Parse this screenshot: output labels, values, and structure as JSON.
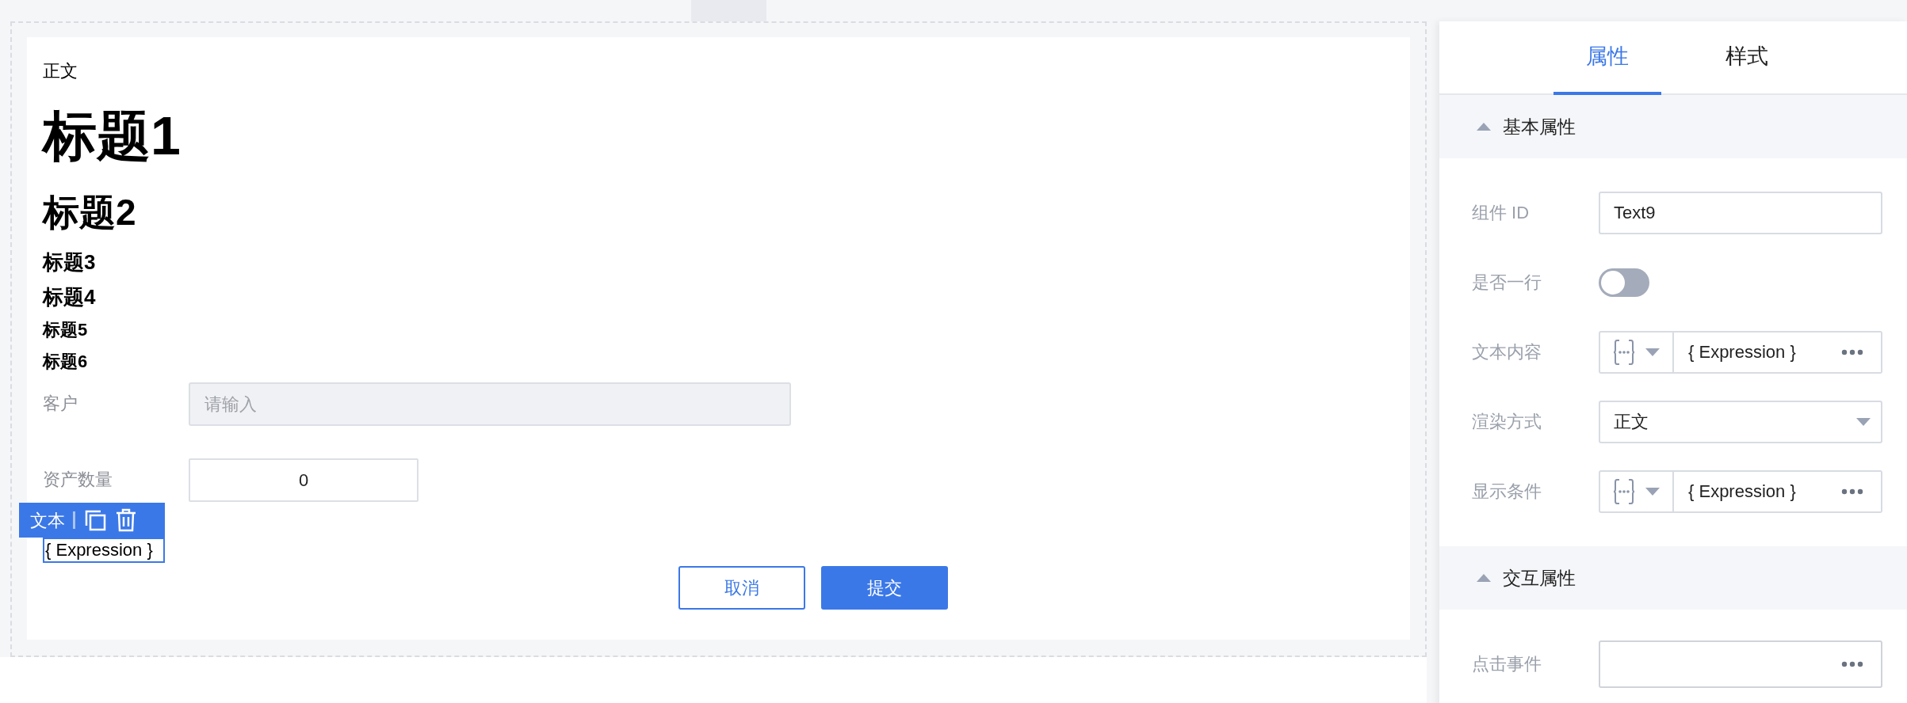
{
  "canvas": {
    "texts": [
      {
        "kind": "body",
        "text": "正文"
      },
      {
        "kind": "h1",
        "text": "标题1"
      },
      {
        "kind": "h2",
        "text": "标题2"
      },
      {
        "kind": "h3",
        "text": "标题3"
      },
      {
        "kind": "h4",
        "text": "标题4"
      },
      {
        "kind": "h5",
        "text": "标题5"
      },
      {
        "kind": "h6",
        "text": "标题6"
      }
    ],
    "form": [
      {
        "label": "客户",
        "placeholder": "请输入",
        "disabled": true
      },
      {
        "label": "资产数量",
        "value": "0",
        "disabled": false
      }
    ],
    "selection_toolbar": {
      "label": "文本"
    },
    "selected_text": "{ Expression }",
    "buttons": [
      {
        "label": "取消",
        "kind": "secondary"
      },
      {
        "label": "提交",
        "kind": "primary"
      }
    ]
  },
  "panel": {
    "tabs": [
      {
        "label": "属性",
        "selected": true
      },
      {
        "label": "样式",
        "selected": false
      }
    ],
    "sections": [
      {
        "title": "基本属性",
        "expanded": true,
        "fields": [
          {
            "kind": "text",
            "label": "组件 ID",
            "value": "Text9"
          },
          {
            "kind": "toggle",
            "label": "是否一行",
            "on": false
          },
          {
            "kind": "expression",
            "label": "文本内容",
            "value": "{ Expression }"
          },
          {
            "kind": "select",
            "label": "渲染方式",
            "value": "正文"
          },
          {
            "kind": "expression",
            "label": "显示条件",
            "value": "{ Expression }"
          }
        ]
      },
      {
        "title": "交互属性",
        "expanded": true,
        "fields": [
          {
            "kind": "action",
            "label": "点击事件"
          }
        ]
      }
    ]
  }
}
